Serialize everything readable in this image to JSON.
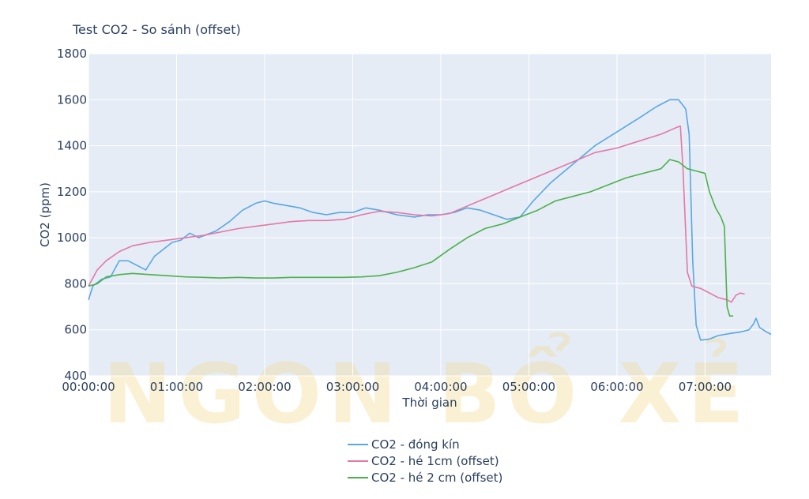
{
  "title": "Test CO2 - So sánh (offset)",
  "watermark": {
    "text": "NGON BỔ XẺ",
    "color": "#f2d98a"
  },
  "chart_data": {
    "type": "line",
    "title": "Test CO2 - So sánh (offset)",
    "xlabel": "Thời gian",
    "ylabel": "CO2 (ppm)",
    "xlim_hours": [
      0,
      7.75
    ],
    "ylim": [
      400,
      1800
    ],
    "yticks": [
      400,
      600,
      800,
      1000,
      1200,
      1400,
      1600,
      1800
    ],
    "xticks": [
      "00:00:00",
      "01:00:00",
      "02:00:00",
      "03:00:00",
      "04:00:00",
      "05:00:00",
      "06:00:00",
      "07:00:00"
    ],
    "plot_background": "#e5ecf6",
    "grid": true,
    "legend_position": "bottom-center",
    "series": [
      {
        "name": "CO2 - đóng kín",
        "color": "#5aa7e0",
        "points": [
          [
            0.0,
            730
          ],
          [
            0.05,
            790
          ],
          [
            0.15,
            820
          ],
          [
            0.25,
            830
          ],
          [
            0.35,
            900
          ],
          [
            0.45,
            900
          ],
          [
            0.55,
            880
          ],
          [
            0.65,
            860
          ],
          [
            0.75,
            920
          ],
          [
            0.85,
            950
          ],
          [
            0.95,
            980
          ],
          [
            1.05,
            990
          ],
          [
            1.15,
            1020
          ],
          [
            1.25,
            1000
          ],
          [
            1.45,
            1030
          ],
          [
            1.6,
            1070
          ],
          [
            1.75,
            1120
          ],
          [
            1.9,
            1150
          ],
          [
            2.0,
            1160
          ],
          [
            2.1,
            1150
          ],
          [
            2.25,
            1140
          ],
          [
            2.4,
            1130
          ],
          [
            2.55,
            1110
          ],
          [
            2.7,
            1100
          ],
          [
            2.85,
            1110
          ],
          [
            3.0,
            1110
          ],
          [
            3.15,
            1130
          ],
          [
            3.3,
            1120
          ],
          [
            3.5,
            1100
          ],
          [
            3.7,
            1090
          ],
          [
            3.85,
            1100
          ],
          [
            4.0,
            1100
          ],
          [
            4.15,
            1110
          ],
          [
            4.3,
            1130
          ],
          [
            4.45,
            1120
          ],
          [
            4.6,
            1100
          ],
          [
            4.75,
            1080
          ],
          [
            4.9,
            1090
          ],
          [
            5.05,
            1160
          ],
          [
            5.25,
            1240
          ],
          [
            5.5,
            1320
          ],
          [
            5.75,
            1400
          ],
          [
            6.0,
            1460
          ],
          [
            6.25,
            1520
          ],
          [
            6.45,
            1570
          ],
          [
            6.6,
            1600
          ],
          [
            6.7,
            1600
          ],
          [
            6.78,
            1560
          ],
          [
            6.82,
            1450
          ],
          [
            6.86,
            900
          ],
          [
            6.9,
            620
          ],
          [
            6.95,
            555
          ],
          [
            7.05,
            560
          ],
          [
            7.15,
            575
          ],
          [
            7.3,
            585
          ],
          [
            7.4,
            590
          ],
          [
            7.5,
            600
          ],
          [
            7.55,
            625
          ],
          [
            7.58,
            650
          ],
          [
            7.62,
            610
          ],
          [
            7.7,
            590
          ],
          [
            7.75,
            580
          ]
        ]
      },
      {
        "name": "CO2 - hé 1cm (offset)",
        "color": "#e477a8",
        "points": [
          [
            0.0,
            790
          ],
          [
            0.1,
            860
          ],
          [
            0.2,
            900
          ],
          [
            0.35,
            940
          ],
          [
            0.5,
            965
          ],
          [
            0.7,
            980
          ],
          [
            0.9,
            990
          ],
          [
            1.1,
            1000
          ],
          [
            1.3,
            1010
          ],
          [
            1.5,
            1025
          ],
          [
            1.7,
            1040
          ],
          [
            1.9,
            1050
          ],
          [
            2.1,
            1060
          ],
          [
            2.3,
            1070
          ],
          [
            2.5,
            1075
          ],
          [
            2.7,
            1075
          ],
          [
            2.9,
            1080
          ],
          [
            3.1,
            1100
          ],
          [
            3.3,
            1115
          ],
          [
            3.5,
            1110
          ],
          [
            3.7,
            1100
          ],
          [
            3.9,
            1095
          ],
          [
            4.1,
            1105
          ],
          [
            4.25,
            1130
          ],
          [
            4.5,
            1170
          ],
          [
            4.75,
            1210
          ],
          [
            5.0,
            1250
          ],
          [
            5.25,
            1290
          ],
          [
            5.5,
            1330
          ],
          [
            5.75,
            1370
          ],
          [
            6.0,
            1390
          ],
          [
            6.25,
            1420
          ],
          [
            6.5,
            1450
          ],
          [
            6.68,
            1480
          ],
          [
            6.72,
            1485
          ],
          [
            6.75,
            1300
          ],
          [
            6.8,
            850
          ],
          [
            6.85,
            790
          ],
          [
            6.95,
            780
          ],
          [
            7.05,
            760
          ],
          [
            7.15,
            740
          ],
          [
            7.25,
            730
          ],
          [
            7.3,
            720
          ],
          [
            7.35,
            750
          ],
          [
            7.4,
            760
          ],
          [
            7.45,
            755
          ]
        ]
      },
      {
        "name": "CO2 - hé 2 cm (offset)",
        "color": "#4cb04c",
        "points": [
          [
            0.0,
            790
          ],
          [
            0.1,
            800
          ],
          [
            0.2,
            830
          ],
          [
            0.35,
            840
          ],
          [
            0.5,
            845
          ],
          [
            0.7,
            840
          ],
          [
            0.9,
            835
          ],
          [
            1.1,
            830
          ],
          [
            1.3,
            828
          ],
          [
            1.5,
            825
          ],
          [
            1.7,
            828
          ],
          [
            1.9,
            825
          ],
          [
            2.1,
            825
          ],
          [
            2.3,
            828
          ],
          [
            2.5,
            828
          ],
          [
            2.7,
            828
          ],
          [
            2.9,
            828
          ],
          [
            3.1,
            830
          ],
          [
            3.3,
            835
          ],
          [
            3.5,
            850
          ],
          [
            3.7,
            870
          ],
          [
            3.9,
            895
          ],
          [
            4.1,
            950
          ],
          [
            4.3,
            1000
          ],
          [
            4.5,
            1040
          ],
          [
            4.7,
            1060
          ],
          [
            4.9,
            1090
          ],
          [
            5.1,
            1120
          ],
          [
            5.3,
            1160
          ],
          [
            5.5,
            1180
          ],
          [
            5.7,
            1200
          ],
          [
            5.9,
            1230
          ],
          [
            6.1,
            1260
          ],
          [
            6.3,
            1280
          ],
          [
            6.45,
            1295
          ],
          [
            6.5,
            1300
          ],
          [
            6.55,
            1320
          ],
          [
            6.6,
            1340
          ],
          [
            6.7,
            1330
          ],
          [
            6.8,
            1300
          ],
          [
            6.9,
            1290
          ],
          [
            7.0,
            1280
          ],
          [
            7.05,
            1200
          ],
          [
            7.12,
            1130
          ],
          [
            7.18,
            1090
          ],
          [
            7.22,
            1050
          ],
          [
            7.25,
            700
          ],
          [
            7.28,
            660
          ],
          [
            7.32,
            660
          ]
        ]
      }
    ]
  }
}
